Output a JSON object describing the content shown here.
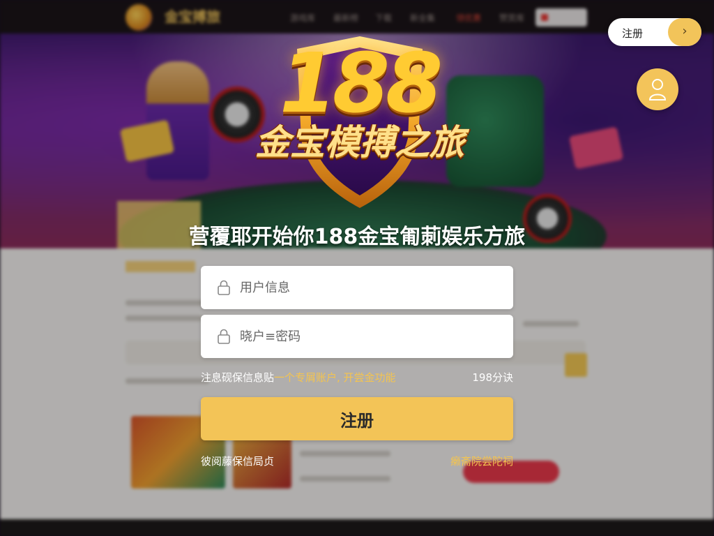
{
  "background_site": {
    "brand": "金宝搏旅",
    "nav": [
      "游戏库",
      "最新榜",
      "下载",
      "新全集",
      "领优惠",
      "赞赏库"
    ]
  },
  "top_register": {
    "label": "注册",
    "arrow": "›"
  },
  "logo": {
    "number": "188",
    "title": "金宝模搏之旅"
  },
  "headline": "营覆耶开始你188金宝匍莿娱乐方旅",
  "form": {
    "username_placeholder": "用户信息",
    "password_placeholder": "晓户≡密码",
    "info_prefix": "注息砚保信息贴",
    "info_highlight": "一个专屑账户, 开尝金功能",
    "info_time": "198分诀",
    "submit_label": "注册",
    "bottom_left": "彼阅藤保信局贞",
    "bottom_right": "癞斋院尝陀祠"
  },
  "colors": {
    "accent_gold": "#f3c457",
    "highlight_text": "#f4c44f"
  }
}
